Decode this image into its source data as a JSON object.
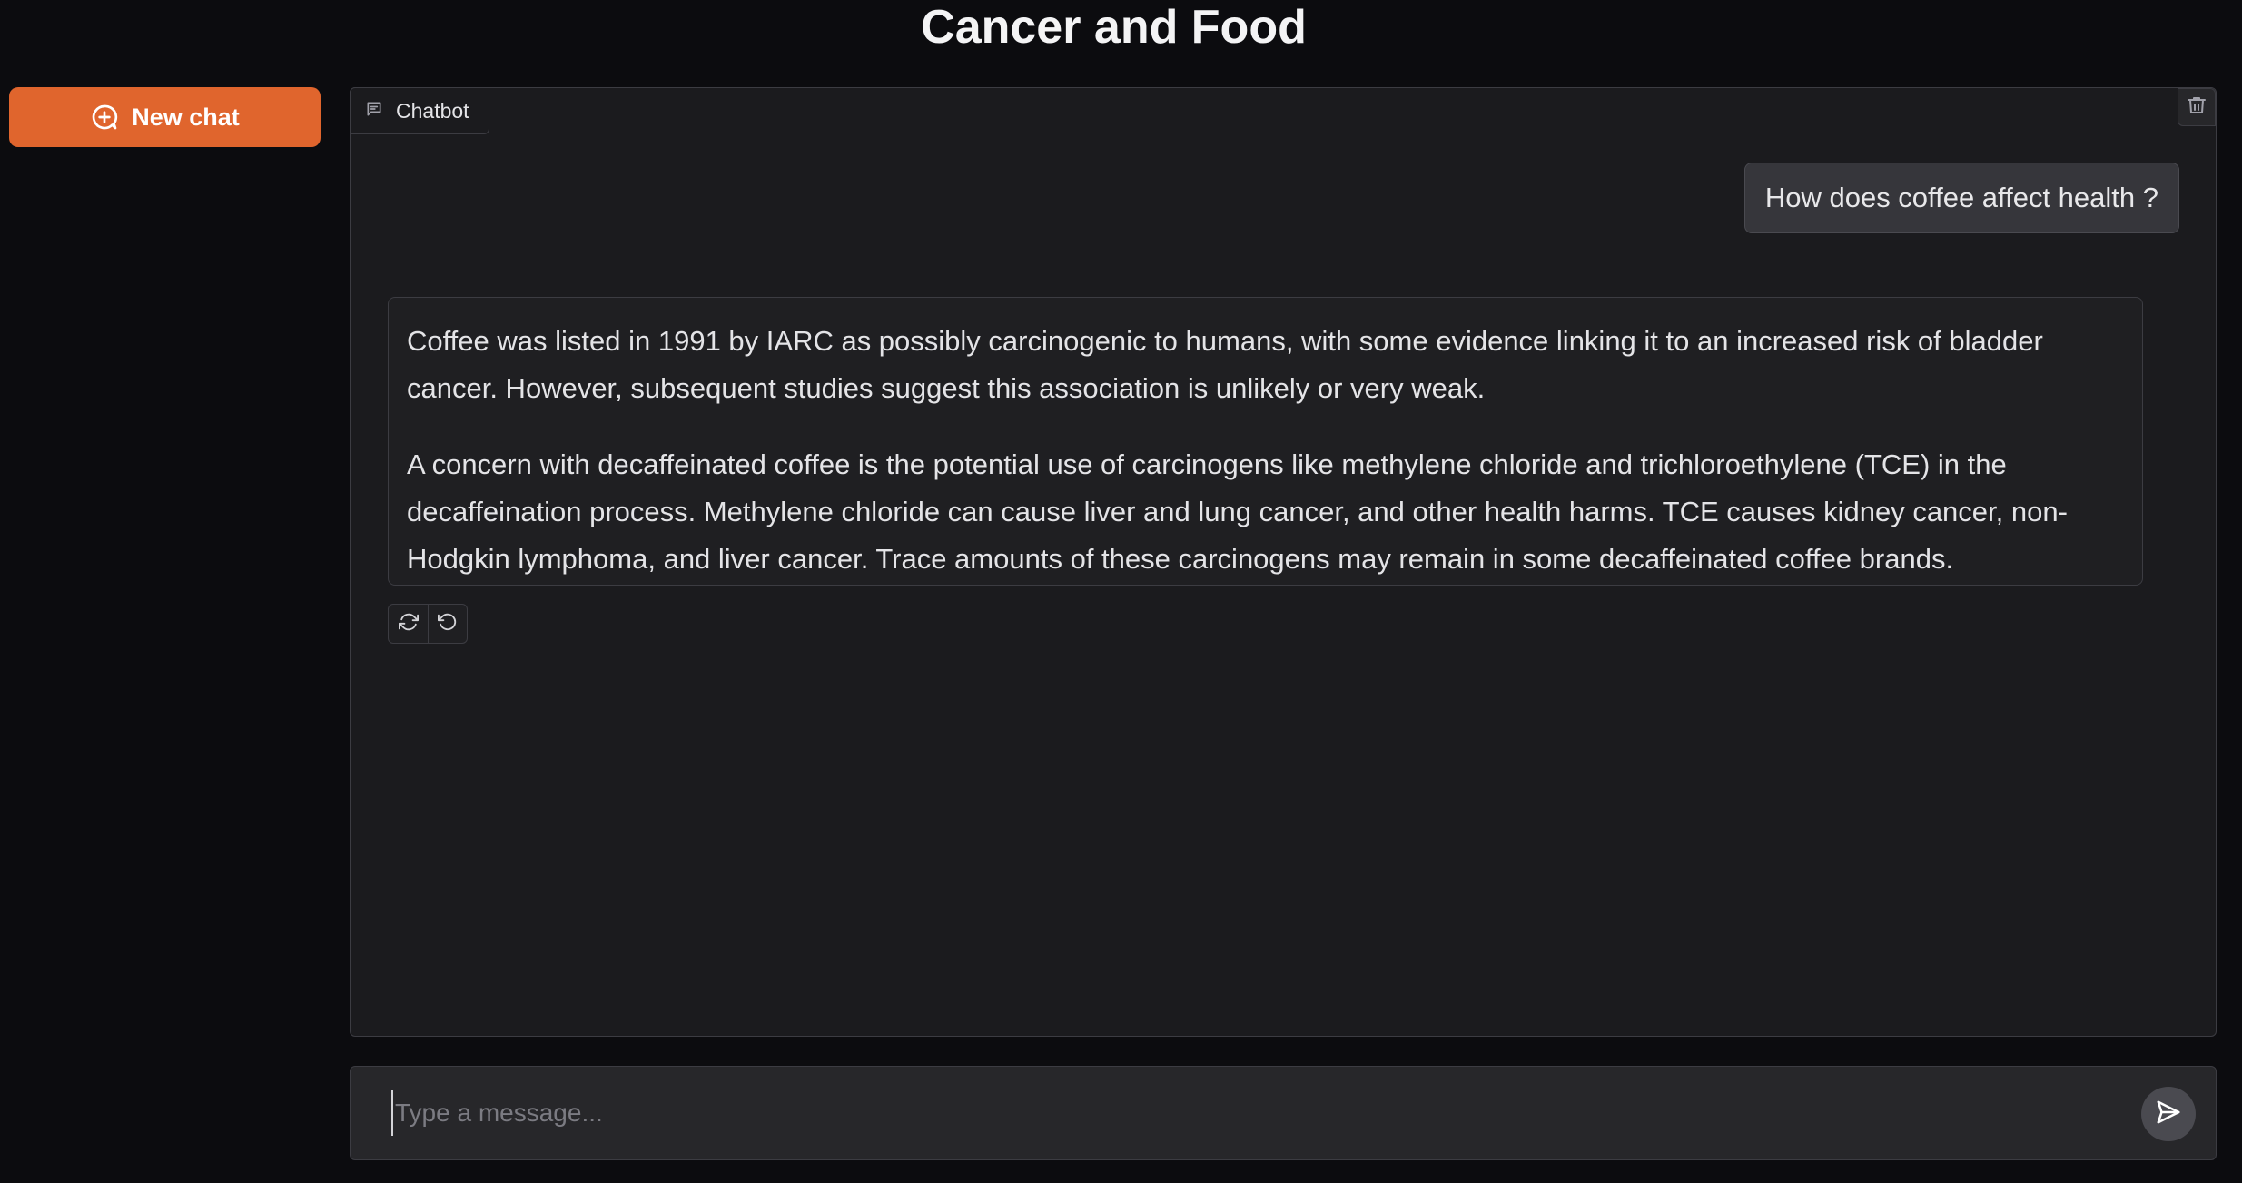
{
  "page": {
    "title": "Cancer and Food"
  },
  "sidebar": {
    "new_chat_label": "New chat",
    "new_chat_icon": "plus-circle-icon"
  },
  "chatbot": {
    "tab_label": "Chatbot",
    "tab_icon": "chat-icon",
    "clear_icon": "trash-icon",
    "messages": [
      {
        "role": "user",
        "text": "How does coffee affect health ?"
      },
      {
        "role": "assistant",
        "paragraphs": [
          "Coffee was listed in 1991 by IARC as possibly carcinogenic to humans, with some evidence linking it to an increased risk of bladder cancer. However, subsequent studies suggest this association is unlikely or very weak.",
          "A concern with decaffeinated coffee is the potential use of carcinogens like methylene chloride and trichloroethylene (TCE) in the decaffeination process. Methylene chloride can cause liver and lung cancer, and other health harms. TCE causes kidney cancer, non-Hodgkin lymphoma, and liver cancer. Trace amounts of these carcinogens may remain in some decaffeinated coffee brands."
        ]
      }
    ],
    "message_actions": [
      "retry-icon",
      "undo-icon"
    ]
  },
  "composer": {
    "value": "",
    "placeholder": "Type a message...",
    "send_icon": "send-icon"
  },
  "colors": {
    "accent": "#e0652d",
    "background": "#0c0c0f",
    "panel": "#1b1b1e",
    "border": "#3c3c42"
  }
}
